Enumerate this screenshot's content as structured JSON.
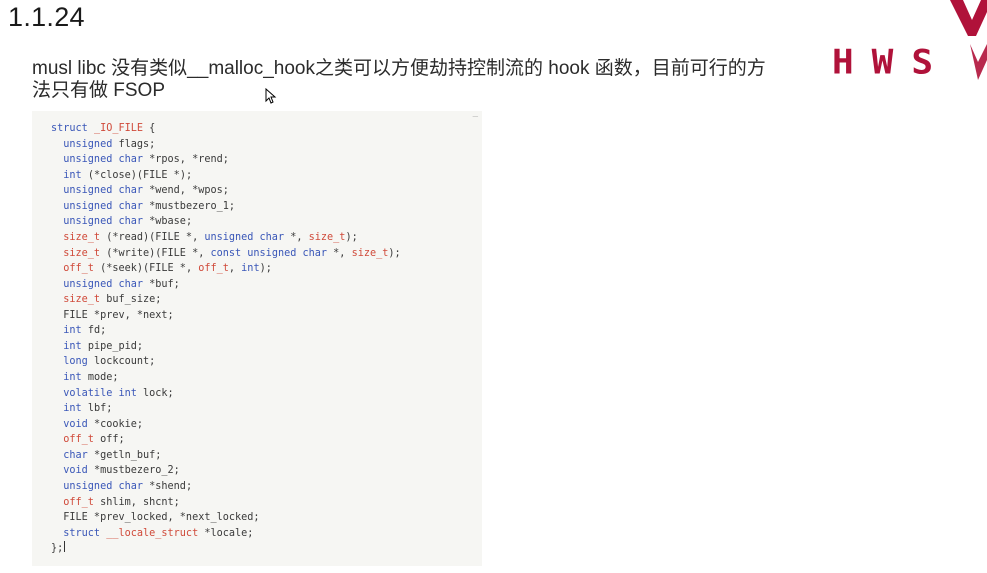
{
  "slide": {
    "number": "1.1.24",
    "paragraph": "musl libc 没有类似__malloc_hook之类可以方便劫持控制流的 hook 函数，目前可行的方法只有做 FSOP"
  },
  "logo": {
    "text": "HWS",
    "color": "#b0123a"
  },
  "code": {
    "lines": [
      [
        {
          "t": "struct ",
          "c": "kw"
        },
        {
          "t": "_IO_FILE",
          "c": "type"
        },
        {
          "t": " {",
          "c": "id"
        }
      ],
      [
        {
          "t": "  unsigned ",
          "c": "kw"
        },
        {
          "t": "flags;",
          "c": "id"
        }
      ],
      [
        {
          "t": "  unsigned char ",
          "c": "kw"
        },
        {
          "t": "*rpos, *rend;",
          "c": "id"
        }
      ],
      [
        {
          "t": "  int ",
          "c": "kw"
        },
        {
          "t": "(*close)(FILE *);",
          "c": "id"
        }
      ],
      [
        {
          "t": "  unsigned char ",
          "c": "kw"
        },
        {
          "t": "*wend, *wpos;",
          "c": "id"
        }
      ],
      [
        {
          "t": "  unsigned char ",
          "c": "kw"
        },
        {
          "t": "*mustbezero_1;",
          "c": "id"
        }
      ],
      [
        {
          "t": "  unsigned char ",
          "c": "kw"
        },
        {
          "t": "*wbase;",
          "c": "id"
        }
      ],
      [
        {
          "t": "  size_t ",
          "c": "type"
        },
        {
          "t": "(*read)(FILE *, ",
          "c": "id"
        },
        {
          "t": "unsigned char ",
          "c": "kw"
        },
        {
          "t": "*, ",
          "c": "id"
        },
        {
          "t": "size_t",
          "c": "type"
        },
        {
          "t": ");",
          "c": "id"
        }
      ],
      [
        {
          "t": "  size_t ",
          "c": "type"
        },
        {
          "t": "(*write)(FILE *, ",
          "c": "id"
        },
        {
          "t": "const unsigned char ",
          "c": "kw"
        },
        {
          "t": "*, ",
          "c": "id"
        },
        {
          "t": "size_t",
          "c": "type"
        },
        {
          "t": ");",
          "c": "id"
        }
      ],
      [
        {
          "t": "  off_t ",
          "c": "type"
        },
        {
          "t": "(*seek)(FILE *, ",
          "c": "id"
        },
        {
          "t": "off_t",
          "c": "type"
        },
        {
          "t": ", ",
          "c": "id"
        },
        {
          "t": "int",
          "c": "kw"
        },
        {
          "t": ");",
          "c": "id"
        }
      ],
      [
        {
          "t": "  unsigned char ",
          "c": "kw"
        },
        {
          "t": "*buf;",
          "c": "id"
        }
      ],
      [
        {
          "t": "  size_t ",
          "c": "type"
        },
        {
          "t": "buf_size;",
          "c": "id"
        }
      ],
      [
        {
          "t": "  FILE *prev, *next;",
          "c": "id"
        }
      ],
      [
        {
          "t": "  int ",
          "c": "kw"
        },
        {
          "t": "fd;",
          "c": "id"
        }
      ],
      [
        {
          "t": "  int ",
          "c": "kw"
        },
        {
          "t": "pipe_pid;",
          "c": "id"
        }
      ],
      [
        {
          "t": "  long ",
          "c": "kw"
        },
        {
          "t": "lockcount;",
          "c": "id"
        }
      ],
      [
        {
          "t": "  int ",
          "c": "kw"
        },
        {
          "t": "mode;",
          "c": "id"
        }
      ],
      [
        {
          "t": "  volatile int ",
          "c": "kw"
        },
        {
          "t": "lock;",
          "c": "id"
        }
      ],
      [
        {
          "t": "  int ",
          "c": "kw"
        },
        {
          "t": "lbf;",
          "c": "id"
        }
      ],
      [
        {
          "t": "  void ",
          "c": "kw"
        },
        {
          "t": "*cookie;",
          "c": "id"
        }
      ],
      [
        {
          "t": "  off_t ",
          "c": "type"
        },
        {
          "t": "off;",
          "c": "id"
        }
      ],
      [
        {
          "t": "  char ",
          "c": "kw"
        },
        {
          "t": "*getln_buf;",
          "c": "id"
        }
      ],
      [
        {
          "t": "  void ",
          "c": "kw"
        },
        {
          "t": "*mustbezero_2;",
          "c": "id"
        }
      ],
      [
        {
          "t": "  unsigned char ",
          "c": "kw"
        },
        {
          "t": "*shend;",
          "c": "id"
        }
      ],
      [
        {
          "t": "  off_t ",
          "c": "type"
        },
        {
          "t": "shlim, shcnt;",
          "c": "id"
        }
      ],
      [
        {
          "t": "  FILE *prev_locked, *next_locked;",
          "c": "id"
        }
      ],
      [
        {
          "t": "  struct ",
          "c": "kw"
        },
        {
          "t": "__locale_struct",
          "c": "type"
        },
        {
          "t": " *locale;",
          "c": "id"
        }
      ],
      [
        {
          "t": "};",
          "c": "id"
        }
      ]
    ]
  }
}
